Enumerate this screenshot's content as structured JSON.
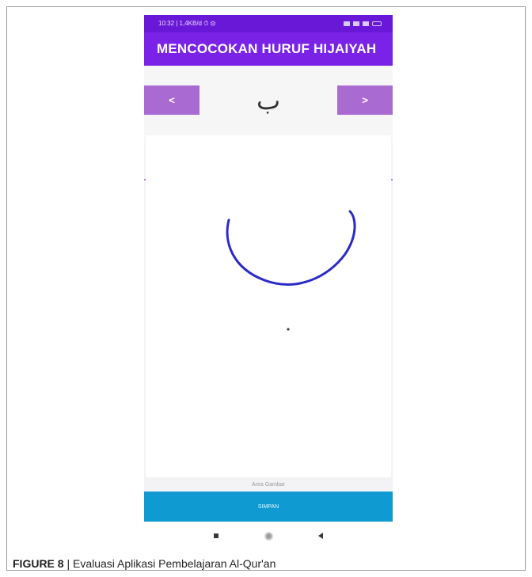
{
  "status_bar": {
    "left_text": "10:32 | 1,4KB/d ⏱ ⚙",
    "right_text": ""
  },
  "app_bar": {
    "title": "MENCOCOKAN HURUF HIJAIYAH"
  },
  "letter_nav": {
    "prev_label": "<",
    "next_label": ">",
    "current_letter": "ب"
  },
  "canvas": {
    "label": "Area Gambar"
  },
  "save_button": {
    "label": "SIMPAN"
  },
  "nav_icons": [
    "recents-square-icon",
    "home-circle-icon",
    "back-triangle-icon"
  ],
  "figure": {
    "label": "FIGURE 8",
    "separator": " | ",
    "caption": "Evaluasi Aplikasi Pembelajaran Al-Qur'an"
  },
  "colors": {
    "status_bar": "#6a18d8",
    "app_bar": "#7a22e6",
    "nav_button": "#a96ad2",
    "stroke": "#2a2ac8",
    "save_button": "#0f9ad1"
  }
}
